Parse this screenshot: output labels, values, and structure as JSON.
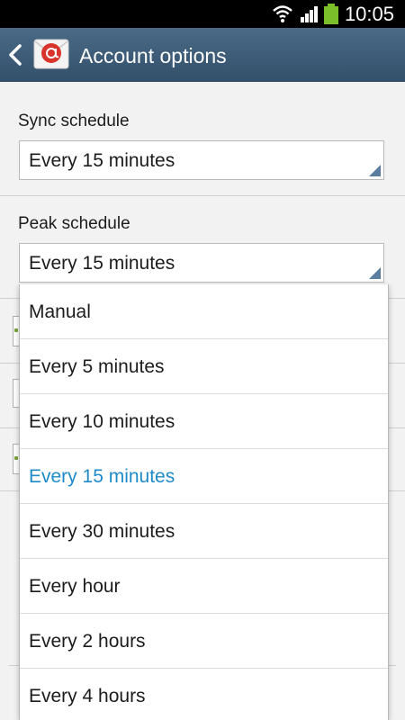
{
  "status_bar": {
    "time": "10:05",
    "icons": [
      "wifi-icon",
      "signal-icon",
      "battery-icon"
    ],
    "battery_color": "#7bbf2a"
  },
  "action_bar": {
    "title": "Account options",
    "back_icon": "chevron-left-icon",
    "app_icon": "email-at-icon",
    "color": "#3d5b76"
  },
  "sync_schedule": {
    "label": "Sync schedule",
    "value": "Every 15 minutes"
  },
  "peak_schedule": {
    "label": "Peak schedule",
    "value": "Every 15 minutes"
  },
  "dropdown": {
    "selected_color": "#1f8ac8",
    "options": [
      "Manual",
      "Every 5 minutes",
      "Every 10 minutes",
      "Every 15 minutes",
      "Every 30 minutes",
      "Every hour",
      "Every 2 hours",
      "Every 4 hours"
    ],
    "selected_option": "Every 15 minutes"
  }
}
